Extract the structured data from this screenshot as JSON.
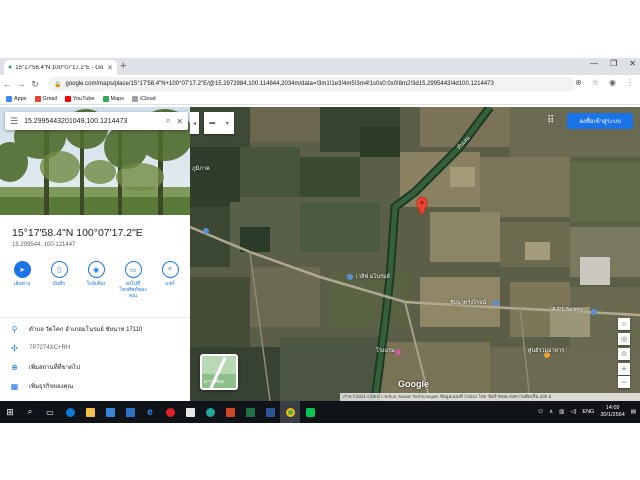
{
  "browser": {
    "tab_title": "15°17'58.4\"N 100°07'17.2\"E - Go",
    "url": "google.com/maps/place/15°17'58.4\"N+100°07'17.2\"E/@15.2972984,100.114844,2034m/data=!3m1!1e3!4m5!3m4!1s0x0:0x0!8m2!3d15.2995443!4d100.1214473",
    "bookmarks": [
      {
        "label": "Apps",
        "color": "#4285f4"
      },
      {
        "label": "Gmail",
        "color": "#ea4335"
      },
      {
        "label": "YouTube",
        "color": "#ff0000"
      },
      {
        "label": "Maps",
        "color": "#34a853"
      },
      {
        "label": "iCloud",
        "color": "#9aa0a6"
      }
    ]
  },
  "search": {
    "value": "15.2995443201049,100.1214473"
  },
  "place": {
    "title": "15°17'58.4\"N 100°07'17.2\"E",
    "coords": "15.299544, 100.121447"
  },
  "actions": [
    {
      "label": "เส้นทาง",
      "icon": "directions-icon",
      "symbol": "➤"
    },
    {
      "label": "บันทึก",
      "icon": "bookmark-icon",
      "symbol": "▯"
    },
    {
      "label": "ใกล้เคียง",
      "icon": "nearby-icon",
      "symbol": "◉"
    },
    {
      "label": "ส่งไปที่โทรศัพท์ของคุณ",
      "icon": "phone-icon",
      "symbol": "▭"
    },
    {
      "label": "แชร์",
      "icon": "share-icon",
      "symbol": "<"
    }
  ],
  "info": {
    "address": "ตำบล วัดโคก อำเภอมโนรมย์ ชัยนาท 17110",
    "pluscode": "7P7274XC+RH",
    "add_place": "เพิ่มสถานที่ที่ขาดไป",
    "add_business": "เพิ่มธุรกิจของคุณ"
  },
  "map": {
    "apps_button": "ลงชื่อเข้าสู่ระบบ",
    "labels": [
      {
        "text": "ทับเสม",
        "name": "map-label-canal"
      },
      {
        "text": "ภูมิภาค",
        "name": "map-label-region"
      },
      {
        "text": "เวลิฟ มโนรมย์",
        "name": "map-label-place"
      },
      {
        "text": "ชัยนาทรุ่งโรจน์",
        "name": "map-label-shop"
      },
      {
        "text": "A.P.L.factory",
        "name": "map-label-factory"
      },
      {
        "text": "ศูนย์รวมอาหาร",
        "name": "map-label-food"
      },
      {
        "text": "โรงแรม",
        "name": "map-label-hotel"
      }
    ],
    "layer_label": "ดาวเทียม",
    "google": "Google",
    "footer": "ภาพ ©2021 CNES / Airbus, Maxar Technologies ข้อมูลแผนที่ ©2021   ไทย   ข้อกำหนด   ส่งความคิดเห็น   200 ม"
  },
  "taskbar": {
    "lang": "ENG",
    "time": "14:09",
    "date": "30/1/2564"
  }
}
